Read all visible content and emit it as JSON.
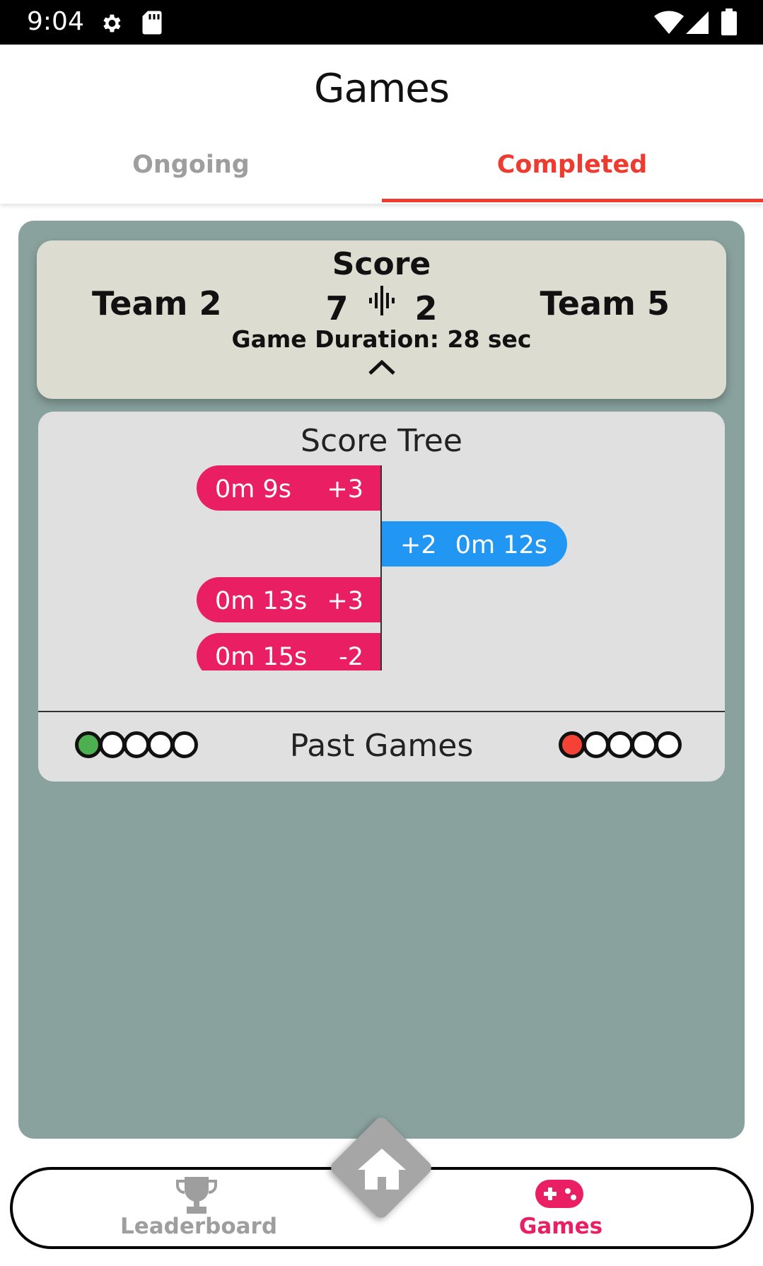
{
  "status_bar": {
    "time": "9:04"
  },
  "header": {
    "title": "Games"
  },
  "tabs": [
    {
      "label": "Ongoing",
      "selected": false
    },
    {
      "label": "Completed",
      "selected": true
    }
  ],
  "game": {
    "team_left": "Team 2",
    "team_right": "Team 5",
    "score_label": "Score",
    "score_left": "7",
    "score_right": "2",
    "duration": "Game Duration: 28 sec"
  },
  "score_tree": {
    "title": "Score Tree",
    "events": [
      {
        "side": "left",
        "time": "0m 9s",
        "delta": "+3"
      },
      {
        "side": "right",
        "time": "0m 12s",
        "delta": "+2"
      },
      {
        "side": "left",
        "time": "0m 13s",
        "delta": "+3"
      },
      {
        "side": "left",
        "time": "0m 15s",
        "delta": "-2"
      },
      {
        "side": "left",
        "time": "",
        "delta": ""
      }
    ]
  },
  "past_games": {
    "label": "Past Games",
    "left_results": [
      "win",
      "none",
      "none",
      "none",
      "none"
    ],
    "right_results": [
      "loss",
      "none",
      "none",
      "none",
      "none"
    ]
  },
  "bottom_nav": {
    "leaderboard_label": "Leaderboard",
    "games_label": "Games",
    "home_icon": "home-icon"
  },
  "colors": {
    "accent": "#ee3b30",
    "team_left_pill": "#e91e63",
    "team_right_pill": "#2196f3",
    "win_dot": "#4caf50",
    "loss_dot": "#f44336",
    "panel_bg": "#89a29d",
    "score_card_bg": "#dddcd0"
  }
}
